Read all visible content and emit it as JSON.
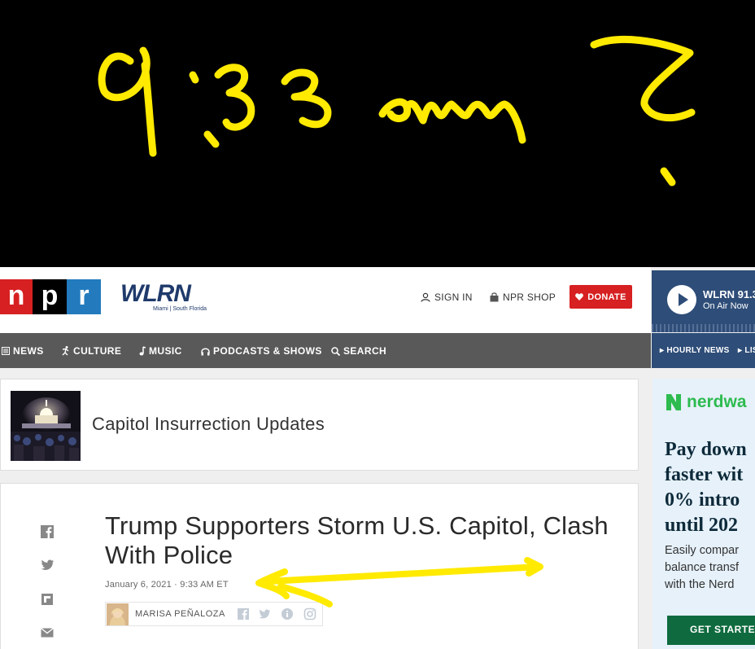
{
  "annotation": {
    "handwritten_text": "9:33 am ?",
    "ink_color": "#ffea00"
  },
  "header": {
    "npr_logo_letters": [
      "n",
      "p",
      "r"
    ],
    "station_logo": "WLRN",
    "station_logo_sub": "Miami | South Florida",
    "signin_label": "SIGN IN",
    "shop_label": "NPR SHOP",
    "donate_label": "DONATE"
  },
  "station_player": {
    "name": "WLRN 91.3",
    "status": "On Air Now",
    "links": [
      "HOURLY NEWS",
      "LIS"
    ]
  },
  "nav": {
    "items": [
      {
        "label": "NEWS",
        "icon": "news-icon"
      },
      {
        "label": "CULTURE",
        "icon": "culture-icon"
      },
      {
        "label": "MUSIC",
        "icon": "music-note-icon"
      },
      {
        "label": "PODCASTS & SHOWS",
        "icon": "headphones-icon"
      },
      {
        "label": "SEARCH",
        "icon": "search-icon"
      }
    ]
  },
  "section": {
    "title": "Capitol Insurrection Updates"
  },
  "article": {
    "headline": "Trump Supporters Storm U.S. Capitol, Clash With Police",
    "dateline": "January 6, 2021 · 9:33 AM ET",
    "author": "MARISA PEÑALOZA",
    "share_icons": [
      "facebook-icon",
      "twitter-icon",
      "flipboard-icon",
      "email-icon"
    ],
    "author_social_icons": [
      "facebook-icon",
      "twitter-icon",
      "info-icon",
      "instagram-icon"
    ]
  },
  "ad": {
    "brand": "nerdwa",
    "headline": "Pay down faster wit 0% intro until 202",
    "headline_lines": [
      "Pay down",
      "faster wit",
      "0% intro",
      "until 202"
    ],
    "body_lines": [
      "Easily compar",
      "balance transf",
      "with the Nerd"
    ],
    "cta": "GET STARTE",
    "brand_color": "#2dbb4f"
  },
  "colors": {
    "npr_red": "#d62021",
    "npr_blue": "#237bbd",
    "nav_bg": "#595959",
    "station_bg": "#2e4d78"
  }
}
